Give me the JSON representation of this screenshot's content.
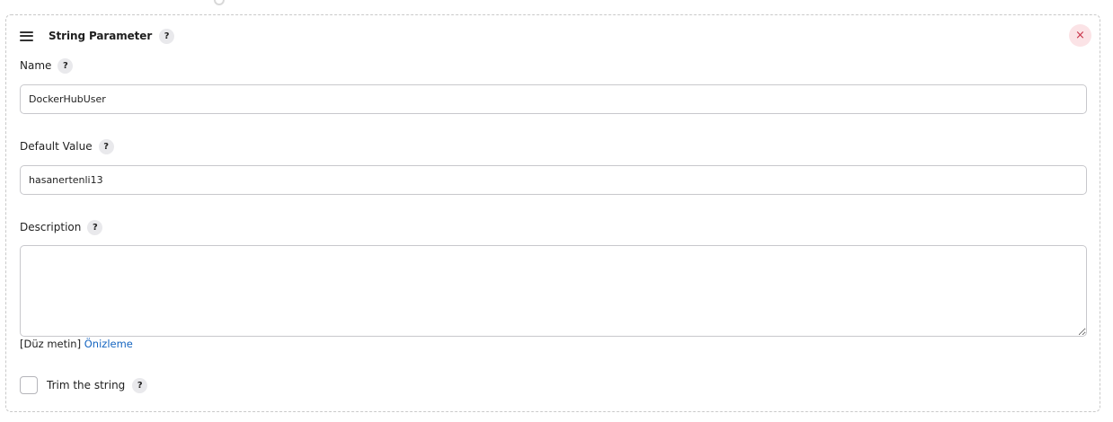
{
  "card": {
    "title": "String Parameter",
    "help": "?",
    "close": "×"
  },
  "fields": {
    "name": {
      "label": "Name",
      "help": "?",
      "value": "DockerHubUser"
    },
    "default_value": {
      "label": "Default Value",
      "help": "?",
      "value": "hasanertenli13"
    },
    "description": {
      "label": "Description",
      "help": "?",
      "value": "",
      "format_label": "[Düz metin]",
      "preview_link": "Önizleme"
    }
  },
  "trim": {
    "label": "Trim the string",
    "help": "?",
    "checked": false
  },
  "colors": {
    "link": "#1565c0",
    "close_bg": "#fbe3e6",
    "close_fg": "#c9344a",
    "border": "#c8c8cc"
  }
}
